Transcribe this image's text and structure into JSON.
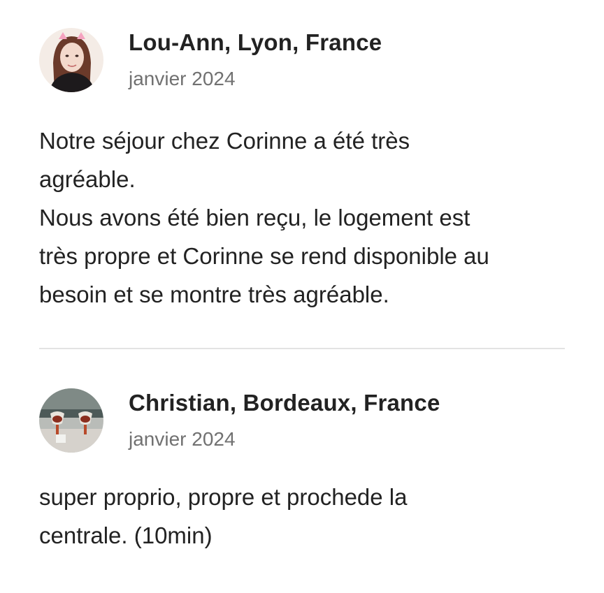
{
  "reviews": [
    {
      "name": "Lou-Ann, Lyon, France",
      "date": "janvier 2024",
      "text": "Notre séjour chez Corinne a été très\nagréable.\nNous avons été bien reçu, le logement est\ntrès propre et Corinne se rend disponible au\nbesoin et se montre très agréable."
    },
    {
      "name": "Christian, Bordeaux, France",
      "date": "janvier 2024",
      "text": "super proprio, propre et prochede la\ncentrale. (10min)"
    }
  ],
  "icons": {
    "avatar_1": "profile-photo",
    "avatar_2": "profile-photo"
  },
  "colors": {
    "text_primary": "#222222",
    "text_secondary": "#717171",
    "divider": "#e3e3e3"
  }
}
